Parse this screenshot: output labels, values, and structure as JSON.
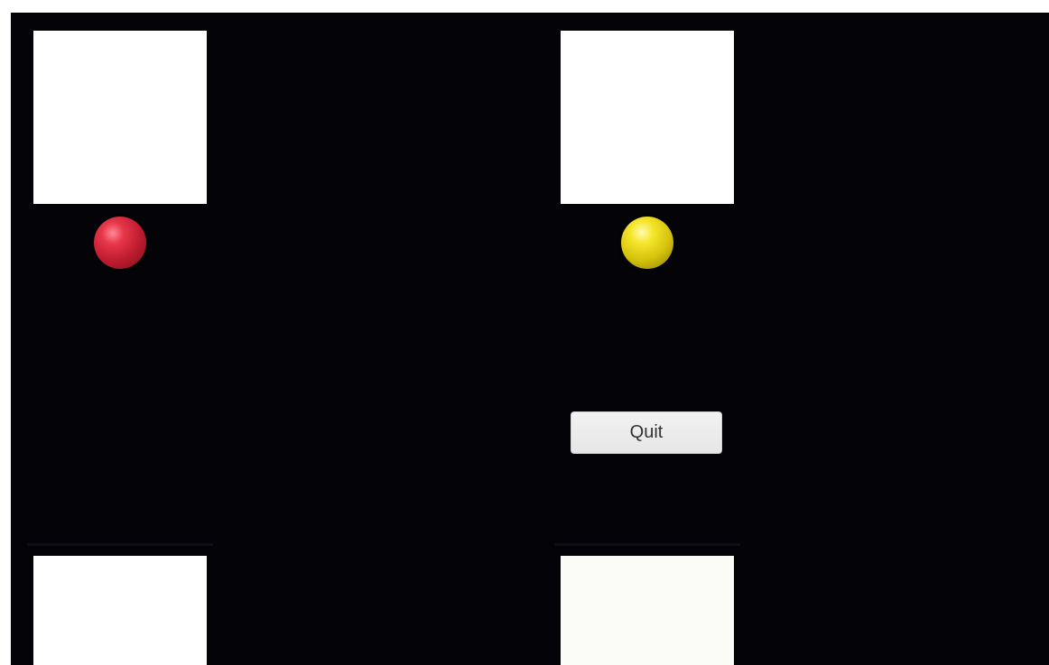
{
  "game": {
    "background_color": "#040408",
    "panel_color": "#ffffff",
    "balls": [
      {
        "color": "red",
        "hex": "#d0283b"
      },
      {
        "color": "yellow",
        "hex": "#e6d51a"
      }
    ],
    "quit_button": {
      "label": "Quit"
    }
  }
}
